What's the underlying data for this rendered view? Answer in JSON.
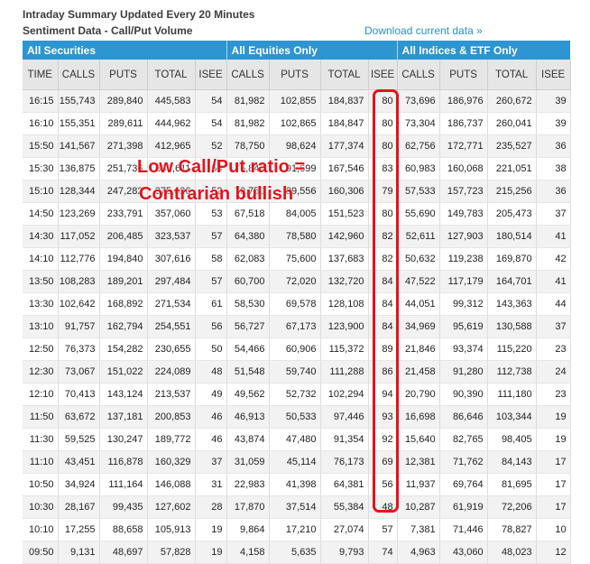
{
  "header": {
    "title": "Intraday Summary Updated Every 20 Minutes",
    "subtitle": "Sentiment Data - Call/Put Volume",
    "download_link": "Download current data »"
  },
  "table": {
    "groups": [
      "All Securities",
      "All Equities Only",
      "All Indices & ETF Only"
    ],
    "columns": [
      "TIME",
      "CALLS",
      "PUTS",
      "TOTAL",
      "ISEE",
      "CALLS",
      "PUTS",
      "TOTAL",
      "ISEE",
      "CALLS",
      "PUTS",
      "TOTAL",
      "ISEE"
    ],
    "rows": [
      [
        "16:15",
        "155,743",
        "289,840",
        "445,583",
        "54",
        "81,982",
        "102,855",
        "184,837",
        "80",
        "73,696",
        "186,976",
        "260,672",
        "39"
      ],
      [
        "16:10",
        "155,351",
        "289,611",
        "444,962",
        "54",
        "81,982",
        "102,865",
        "184,847",
        "80",
        "73,304",
        "186,737",
        "260,041",
        "39"
      ],
      [
        "15:50",
        "141,567",
        "271,398",
        "412,965",
        "52",
        "78,750",
        "98,624",
        "177,374",
        "80",
        "62,756",
        "172,771",
        "235,527",
        "36"
      ],
      [
        "15:30",
        "136,875",
        "251,736",
        "388,611",
        "54",
        "75,847",
        "91,699",
        "167,546",
        "83",
        "60,983",
        "160,068",
        "221,051",
        "38"
      ],
      [
        "15:10",
        "128,344",
        "247,282",
        "375,626",
        "52",
        "70,750",
        "89,556",
        "160,306",
        "79",
        "57,533",
        "157,723",
        "215,256",
        "36"
      ],
      [
        "14:50",
        "123,269",
        "233,791",
        "357,060",
        "53",
        "67,518",
        "84,005",
        "151,523",
        "80",
        "55,690",
        "149,783",
        "205,473",
        "37"
      ],
      [
        "14:30",
        "117,052",
        "206,485",
        "323,537",
        "57",
        "64,380",
        "78,580",
        "142,960",
        "82",
        "52,611",
        "127,903",
        "180,514",
        "41"
      ],
      [
        "14:10",
        "112,776",
        "194,840",
        "307,616",
        "58",
        "62,083",
        "75,600",
        "137,683",
        "82",
        "50,632",
        "119,238",
        "169,870",
        "42"
      ],
      [
        "13:50",
        "108,283",
        "189,201",
        "297,484",
        "57",
        "60,700",
        "72,020",
        "132,720",
        "84",
        "47,522",
        "117,179",
        "164,701",
        "41"
      ],
      [
        "13:30",
        "102,642",
        "168,892",
        "271,534",
        "61",
        "58,530",
        "69,578",
        "128,108",
        "84",
        "44,051",
        "99,312",
        "143,363",
        "44"
      ],
      [
        "13:10",
        "91,757",
        "162,794",
        "254,551",
        "56",
        "56,727",
        "67,173",
        "123,900",
        "84",
        "34,969",
        "95,619",
        "130,588",
        "37"
      ],
      [
        "12:50",
        "76,373",
        "154,282",
        "230,655",
        "50",
        "54,466",
        "60,906",
        "115,372",
        "89",
        "21,846",
        "93,374",
        "115,220",
        "23"
      ],
      [
        "12:30",
        "73,067",
        "151,022",
        "224,089",
        "48",
        "51,548",
        "59,740",
        "111,288",
        "86",
        "21,458",
        "91,280",
        "112,738",
        "24"
      ],
      [
        "12:10",
        "70,413",
        "143,124",
        "213,537",
        "49",
        "49,562",
        "52,732",
        "102,294",
        "94",
        "20,790",
        "90,390",
        "111,180",
        "23"
      ],
      [
        "11:50",
        "63,672",
        "137,181",
        "200,853",
        "46",
        "46,913",
        "50,533",
        "97,446",
        "93",
        "16,698",
        "86,646",
        "103,344",
        "19"
      ],
      [
        "11:30",
        "59,525",
        "130,247",
        "189,772",
        "46",
        "43,874",
        "47,480",
        "91,354",
        "92",
        "15,640",
        "82,765",
        "98,405",
        "19"
      ],
      [
        "11:10",
        "43,451",
        "116,878",
        "160,329",
        "37",
        "31,059",
        "45,114",
        "76,173",
        "69",
        "12,381",
        "71,762",
        "84,143",
        "17"
      ],
      [
        "10:50",
        "34,924",
        "111,164",
        "146,088",
        "31",
        "22,983",
        "41,398",
        "64,381",
        "56",
        "11,937",
        "69,764",
        "81,695",
        "17"
      ],
      [
        "10:30",
        "28,167",
        "99,435",
        "127,602",
        "28",
        "17,870",
        "37,514",
        "55,384",
        "48",
        "10,287",
        "61,919",
        "72,206",
        "17"
      ],
      [
        "10:10",
        "17,255",
        "88,658",
        "105,913",
        "19",
        "9,864",
        "17,210",
        "27,074",
        "57",
        "7,381",
        "71,446",
        "78,827",
        "10"
      ],
      [
        "09:50",
        "9,131",
        "48,697",
        "57,828",
        "19",
        "4,158",
        "5,635",
        "9,793",
        "74",
        "4,963",
        "43,060",
        "48,023",
        "12"
      ]
    ]
  },
  "annotation": {
    "line1": "Low Call/Put ratio =",
    "line2": "Contrarian bullish",
    "color": "#e3131b"
  },
  "colors": {
    "group_header_bg": "#2c95d2",
    "link": "#2a8fc9",
    "highlight": "#e3131b"
  }
}
